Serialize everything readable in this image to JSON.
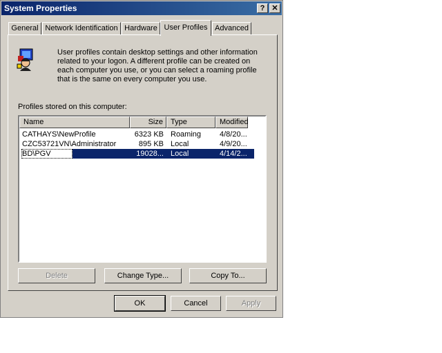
{
  "window": {
    "title": "System Properties",
    "help_label": "?",
    "close_label": "✕"
  },
  "tabs": [
    {
      "label": "General"
    },
    {
      "label": "Network Identification"
    },
    {
      "label": "Hardware"
    },
    {
      "label": "User Profiles"
    },
    {
      "label": "Advanced"
    }
  ],
  "panel": {
    "description_lines": [
      "User profiles contain desktop settings and other information",
      "related to your logon.  A different profile can be created on",
      "each computer you use, or you can select a roaming profile",
      "that is the same on every computer you use."
    ],
    "list_label": "Profiles stored on this computer:",
    "columns": [
      "Name",
      "Size",
      "Type",
      "Modified"
    ],
    "rows": [
      {
        "name": "CATHAYS\\NewProfile",
        "size": "6323 KB",
        "type": "Roaming",
        "modified": "4/8/20..."
      },
      {
        "name": "CZC53721VN\\Administrator",
        "size": "895 KB",
        "type": "Local",
        "modified": "4/9/20..."
      },
      {
        "name": "BD\\PGV",
        "size": "19028...",
        "type": "Local",
        "modified": "4/14/2..."
      }
    ],
    "buttons": {
      "delete": "Delete",
      "change_type": "Change Type...",
      "copy_to": "Copy To..."
    }
  },
  "footer": {
    "ok": "OK",
    "cancel": "Cancel",
    "apply": "Apply"
  },
  "colors": {
    "titlebar": "#0a246a",
    "selection": "#0a246a",
    "face": "#d4d0c8"
  }
}
